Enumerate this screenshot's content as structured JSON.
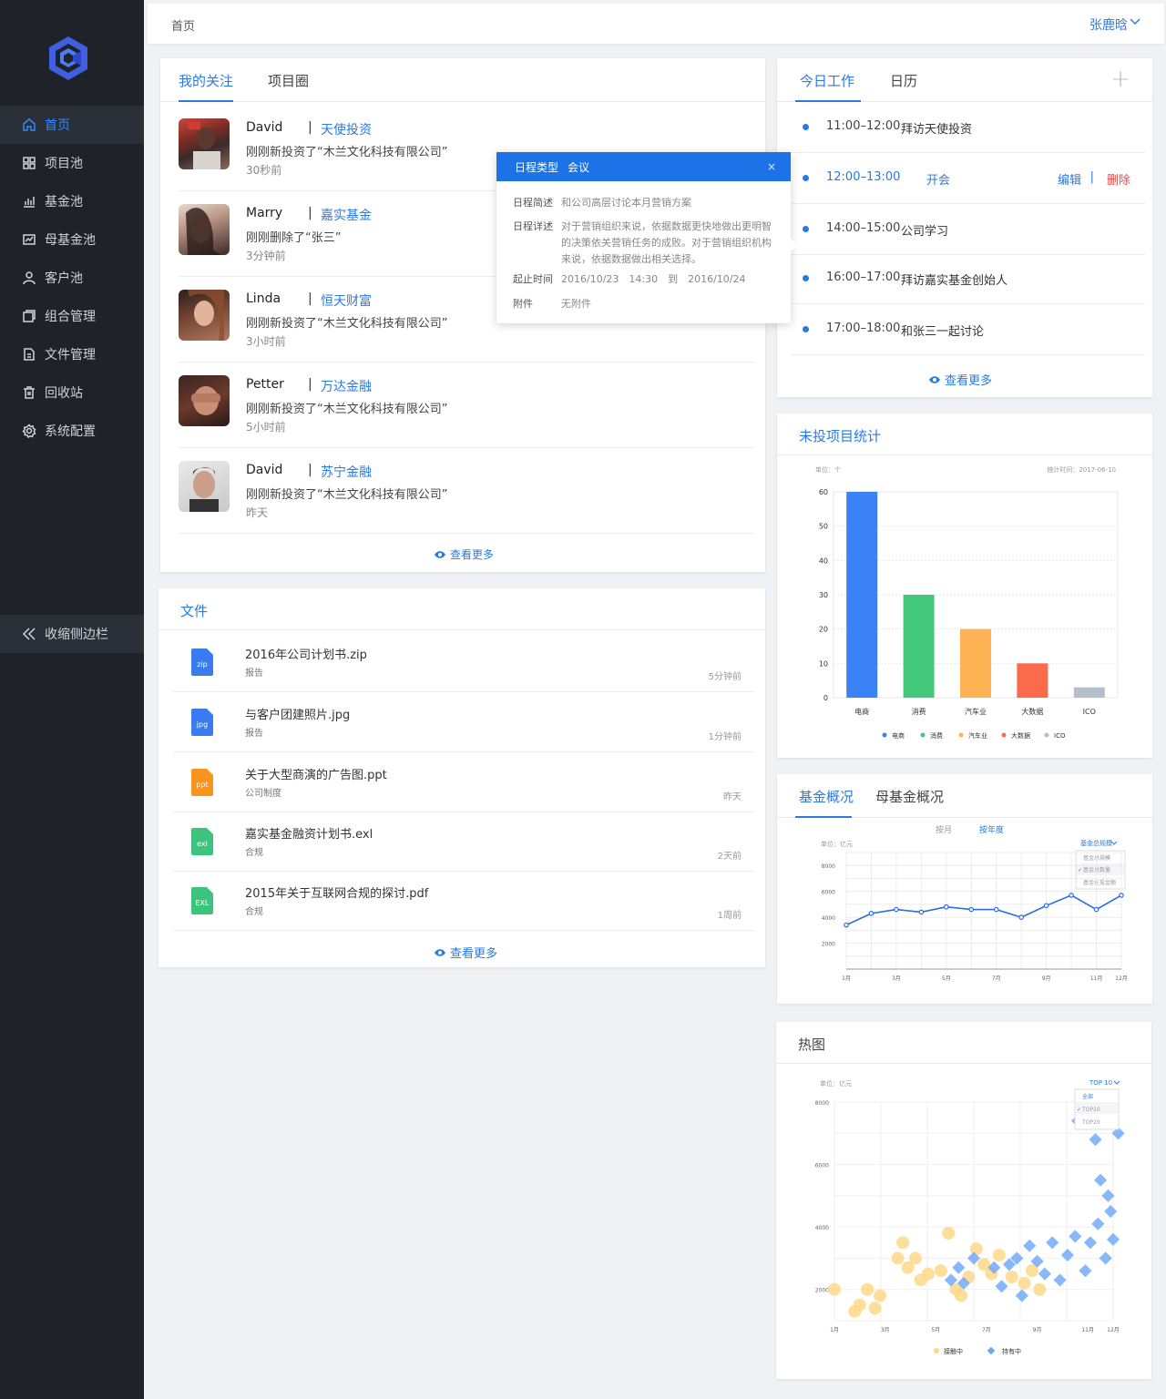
{
  "brand": {
    "accent": "#2a7ae2",
    "sidebar_bg": "#1f2229"
  },
  "sidebar": {
    "items": [
      {
        "label": "首页",
        "icon": "home-icon"
      },
      {
        "label": "项目池",
        "icon": "grid-icon"
      },
      {
        "label": "基金池",
        "icon": "bar-chart-icon"
      },
      {
        "label": "母基金池",
        "icon": "line-chart-icon"
      },
      {
        "label": "客户池",
        "icon": "user-icon"
      },
      {
        "label": "组合管理",
        "icon": "layers-icon"
      },
      {
        "label": "文件管理",
        "icon": "file-icon"
      },
      {
        "label": "回收站",
        "icon": "trash-icon"
      },
      {
        "label": "系统配置",
        "icon": "gear-icon"
      }
    ],
    "collapse_label": "收缩侧边栏"
  },
  "header": {
    "breadcrumb": "首页",
    "user": "张鹿晗"
  },
  "follow": {
    "tabs": [
      "我的关注",
      "项目圈"
    ],
    "items": [
      {
        "name": "David",
        "org": "天使投资",
        "action": "刚刚新投资了“木兰文化科技有限公司”",
        "time": "30秒前"
      },
      {
        "name": "Marry",
        "org": "嘉实基金",
        "action": "刚刚删除了“张三”",
        "time": "3分钟前"
      },
      {
        "name": "Linda",
        "org": "恒天财富",
        "action": "刚刚新投资了“木兰文化科技有限公司”",
        "time": "3小时前"
      },
      {
        "name": "Petter",
        "org": "万达金融",
        "action": "刚刚新投资了“木兰文化科技有限公司”",
        "time": "5小时前"
      },
      {
        "name": "David",
        "org": "苏宁金融",
        "action": "刚刚新投资了“木兰文化科技有限公司”",
        "time": "昨天"
      }
    ],
    "more": "查看更多"
  },
  "popup": {
    "type_label": "日程类型",
    "type_value": "会议",
    "summary_label": "日程简述",
    "summary_value": "和公司高层讨论本月营销方案",
    "detail_label": "日程详述",
    "detail_lines": [
      "对于营销组织来说，依据数据更快地做出更明智",
      "的决策依关营销任务的成败。对于营销组织机构",
      "来说，依据数据做出相关选择。"
    ],
    "time_label": "起止时间",
    "time_value": "2016/10/23　14:30　到　2016/10/24",
    "attach_label": "附件",
    "attach_value": "无附件",
    "close": "×"
  },
  "today": {
    "tabs": [
      "今日工作",
      "日历"
    ],
    "add": "+",
    "items": [
      {
        "time": "11:00–12:00",
        "title": "拜访天使投资"
      },
      {
        "time": "12:00–13:00",
        "title": "开会"
      },
      {
        "time": "14:00–15:00",
        "title": "公司学习"
      },
      {
        "time": "16:00–17:00",
        "title": "拜访嘉实基金创始人"
      },
      {
        "time": "17:00–18:00",
        "title": "和张三一起讨论"
      }
    ],
    "edit": "编辑",
    "sep": "|",
    "delete": "删除",
    "more": "查看更多"
  },
  "files": {
    "title": "文件",
    "items": [
      {
        "name": "2016年公司计划书.zip",
        "tag": "报告",
        "time": "5分钟前",
        "ext": "zip",
        "color": "#3a7cf0"
      },
      {
        "name": "与客户团建照片.jpg",
        "tag": "报告",
        "time": "1分钟前",
        "ext": "jpg",
        "color": "#3a7cf0"
      },
      {
        "name": "关于大型商演的广告图.ppt",
        "tag": "公司制度",
        "time": "昨天",
        "ext": "ppt",
        "color": "#f7941d"
      },
      {
        "name": "嘉实基金融资计划书.exl",
        "tag": "合规",
        "time": "2天前",
        "ext": "exl",
        "color": "#3cc47c"
      },
      {
        "name": "2015年关于互联网合规的探讨.pdf",
        "tag": "合规",
        "time": "1周前",
        "ext": "EXL",
        "color": "#3cc47c"
      }
    ],
    "more": "查看更多"
  },
  "stats": {
    "title": "未投项目统计",
    "unit": "单位：个",
    "stamp": "统计时间：2017-06-10",
    "chart_data": {
      "type": "bar",
      "categories": [
        "电商",
        "消费",
        "汽车业",
        "大数据",
        "ICO"
      ],
      "values": [
        60,
        30,
        20,
        10,
        3
      ],
      "colors": [
        "#3b82f6",
        "#44c97b",
        "#fdb354",
        "#fb6a4a",
        "#b5bfc9"
      ],
      "yticks": [
        0,
        10,
        20,
        30,
        40,
        50,
        60
      ],
      "ylim": [
        0,
        60
      ],
      "legend": "bottom"
    }
  },
  "fund": {
    "tabs": [
      "基金概况",
      "母基金概况"
    ],
    "switch": [
      "按月",
      "按年度"
    ],
    "unit": "单位：亿元",
    "dropdown": {
      "selected": "基金总规模",
      "options": [
        "基金总规模",
        "基金总数量",
        "基金在投金额"
      ]
    },
    "chart_data": {
      "type": "line",
      "x": [
        "1月",
        "2月",
        "3月",
        "4月",
        "5月",
        "6月",
        "7月",
        "8月",
        "9月",
        "10月",
        "11月",
        "12月"
      ],
      "xticks": [
        "1月",
        "3月",
        "5月",
        "7月",
        "9月",
        "11月",
        "12月"
      ],
      "values": [
        3400,
        4300,
        4600,
        4400,
        4800,
        4600,
        4600,
        4000,
        4900,
        5700,
        4600,
        5700
      ],
      "yticks": [
        2000,
        4000,
        6000,
        8000
      ],
      "ylim": [
        0,
        9000
      ]
    }
  },
  "heat": {
    "title": "热图",
    "unit": "单位：亿元",
    "dropdown": {
      "selected": "TOP 10",
      "options": [
        "全部",
        "TOP10",
        "TOP20"
      ]
    },
    "chart_data": {
      "type": "scatter",
      "xticks": [
        "1月",
        "3月",
        "5月",
        "7月",
        "9月",
        "11月",
        "12月"
      ],
      "yticks": [
        2000,
        4000,
        6000,
        8000
      ],
      "series": [
        {
          "name": "接触中",
          "color": "#fdd88a",
          "points": [
            [
              1,
              2000
            ],
            [
              1.8,
              1300
            ],
            [
              2,
              1500
            ],
            [
              2.3,
              2000
            ],
            [
              2.6,
              1400
            ],
            [
              2.8,
              1800
            ],
            [
              3.5,
              3000
            ],
            [
              3.7,
              3500
            ],
            [
              3.9,
              2700
            ],
            [
              4.2,
              3000
            ],
            [
              4.4,
              2300
            ],
            [
              4.7,
              2500
            ],
            [
              5.2,
              2600
            ],
            [
              5.5,
              3800
            ],
            [
              5.8,
              2000
            ],
            [
              6,
              1800
            ],
            [
              6.3,
              2400
            ],
            [
              6.6,
              3300
            ],
            [
              6.9,
              2800
            ],
            [
              7.2,
              2500
            ],
            [
              7.5,
              3100
            ],
            [
              8,
              2400
            ],
            [
              8.5,
              2200
            ],
            [
              8.8,
              2600
            ],
            [
              9.1,
              2000
            ]
          ]
        },
        {
          "name": "持有中",
          "color": "#6aa6f7",
          "points": [
            [
              5.6,
              2300
            ],
            [
              5.9,
              2700
            ],
            [
              6.1,
              2200
            ],
            [
              6.5,
              3000
            ],
            [
              7.3,
              2700
            ],
            [
              7.6,
              2100
            ],
            [
              7.9,
              2800
            ],
            [
              8.2,
              3000
            ],
            [
              8.4,
              1800
            ],
            [
              8.7,
              3400
            ],
            [
              9,
              2900
            ],
            [
              9.3,
              2500
            ],
            [
              9.6,
              3500
            ],
            [
              9.9,
              2300
            ],
            [
              10.2,
              3100
            ],
            [
              10.5,
              3700
            ],
            [
              10.9,
              2600
            ],
            [
              11.1,
              3500
            ],
            [
              11.4,
              4100
            ],
            [
              11.7,
              3000
            ],
            [
              12,
              3600
            ],
            [
              11.5,
              5500
            ],
            [
              11.8,
              5000
            ],
            [
              11.3,
              6800
            ],
            [
              12.2,
              7000
            ],
            [
              11.9,
              4500
            ],
            [
              10.6,
              7400
            ]
          ]
        }
      ],
      "legend": "bottom"
    }
  }
}
